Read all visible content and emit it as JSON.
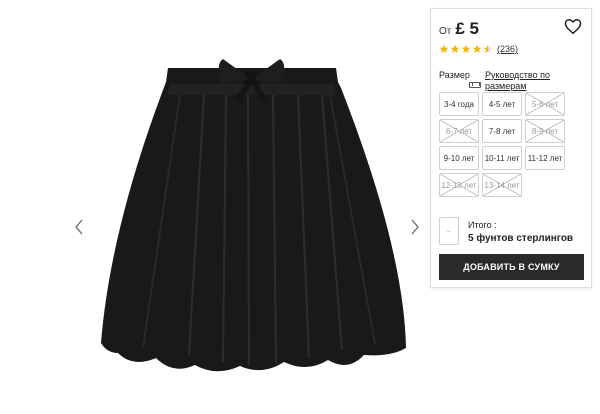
{
  "product": {
    "image_icon": "pleated-skirt-with-bow"
  },
  "gallery": {
    "prev_icon": "chevron-left-icon",
    "next_icon": "chevron-right-icon"
  },
  "price": {
    "prefix": "От",
    "value": "£ 5"
  },
  "rating": {
    "stars": 4.5,
    "max_stars": 5,
    "count": "(236)"
  },
  "sizes": {
    "label": "Размер",
    "guide": "Руководство по размерам",
    "options": [
      {
        "label": "3-4 года",
        "available": true
      },
      {
        "label": "4-5 лет",
        "available": true
      },
      {
        "label": "5-6 лет",
        "available": false
      },
      {
        "label": "6-7 лет",
        "available": false
      },
      {
        "label": "7-8 лет",
        "available": true
      },
      {
        "label": "8-9 лет",
        "available": false
      },
      {
        "label": "9-10 лет",
        "available": true
      },
      {
        "label": "10-11 лет",
        "available": true
      },
      {
        "label": "11-12 лет",
        "available": true
      },
      {
        "label": "12-13 лет",
        "available": false
      },
      {
        "label": "13-14 лет",
        "available": false
      }
    ]
  },
  "total": {
    "label": "Итого :",
    "value": "5 фунтов стерлингов"
  },
  "cart": {
    "button_label": "ДОБАВИТЬ В СУМКУ"
  },
  "colors": {
    "button_bg": "#2a2a2a",
    "star": "#f2b705",
    "skirt": "#1b1b1c"
  }
}
